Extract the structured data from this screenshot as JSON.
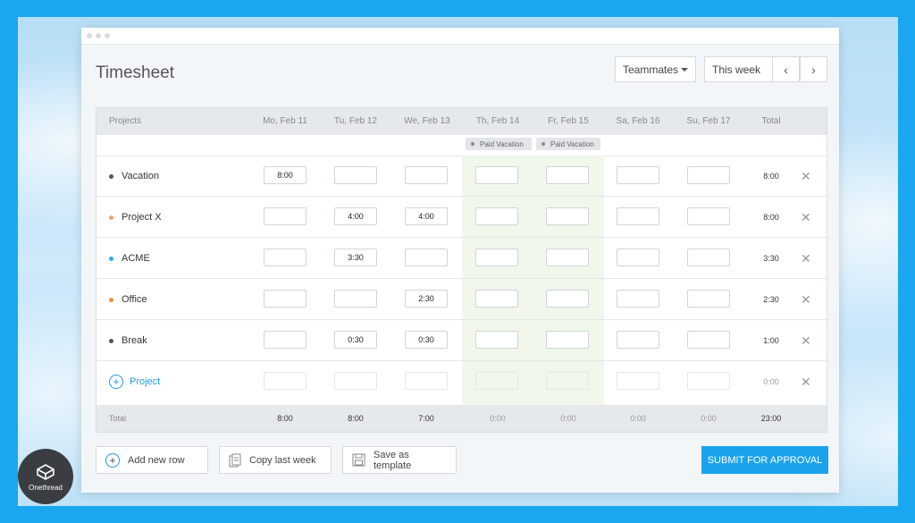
{
  "app": {
    "title": "Timesheet",
    "brand": "Onethread",
    "accent_color": "#1aa3ec"
  },
  "header": {
    "teammates_label": "Teammates",
    "week_label": "This week",
    "prev_icon": "chevron-left-icon",
    "next_icon": "chevron-right-icon"
  },
  "table": {
    "columns": [
      "Projects",
      "Mo, Feb 11",
      "Tu, Feb 12",
      "We, Feb 13",
      "Th, Feb 14",
      "Fr, Feb 15",
      "Sa, Feb 16",
      "Su, Feb 17",
      "Total"
    ],
    "badges": [
      "Paid Vacation",
      "Paid Vacation"
    ],
    "rows": [
      {
        "name": "Vacation",
        "color": "#555555",
        "cells": [
          "8:00",
          "",
          "",
          "",
          "",
          "",
          ""
        ],
        "total": "8:00"
      },
      {
        "name": "Project X",
        "color": "#f0a36a",
        "cells": [
          "",
          "4:00",
          "4:00",
          "",
          "",
          "",
          ""
        ],
        "total": "8:00"
      },
      {
        "name": "ACME",
        "color": "#26b0ef",
        "cells": [
          "",
          "3:30",
          "",
          "",
          "",
          "",
          ""
        ],
        "total": "3:30"
      },
      {
        "name": "Office",
        "color": "#f08a3c",
        "cells": [
          "",
          "",
          "2:30",
          "",
          "",
          "",
          ""
        ],
        "total": "2:30"
      },
      {
        "name": "Break",
        "color": "#555555",
        "cells": [
          "",
          "0:30",
          "0:30",
          "",
          "",
          "",
          ""
        ],
        "total": "1:00"
      }
    ],
    "add_project_label": "Project",
    "add_project_total": "0:00",
    "footer": {
      "label": "Total",
      "values": [
        "8:00",
        "8:00",
        "7:00",
        "0:00",
        "0:00",
        "0:00",
        "0:00"
      ],
      "grand_total": "23:00"
    }
  },
  "actions": {
    "add_row": "Add new row",
    "copy_last_week": "Copy last week",
    "save_template": "Save as template",
    "submit": "SUBMIT FOR APPROVAL"
  }
}
